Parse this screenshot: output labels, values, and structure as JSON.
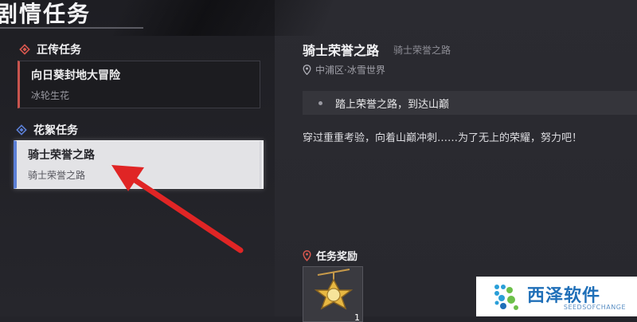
{
  "page": {
    "title": "剧情任务"
  },
  "sections": {
    "main": {
      "label": "正传任务",
      "icon": "main-quest-diamond-icon",
      "color": "#d9584f"
    },
    "side": {
      "label": "花絮任务",
      "icon": "side-quest-diamond-icon",
      "color": "#5b7fd6"
    }
  },
  "quests": {
    "main": {
      "name": "向日葵封地大冒险",
      "subtitle": "冰轮生花"
    },
    "selected": {
      "name": "骑士荣誉之路",
      "subtitle": "骑士荣誉之路"
    }
  },
  "detail": {
    "title": "骑士荣誉之路",
    "subtitle": "骑士荣誉之路",
    "location": "中浦区·冰雪世界",
    "objective": "踏上荣誉之路，到达山巅",
    "description": "穿过重重考验，向着山巅冲刺……为了无上的荣耀，努力吧！"
  },
  "rewards": {
    "label": "任务奖励",
    "items": [
      {
        "icon": "gold-star-medal-icon",
        "count": "1"
      }
    ]
  },
  "annotation": {
    "icon": "red-arrow-icon",
    "color": "#e02525"
  },
  "watermark": {
    "cn": "西泽软件",
    "en": "SEEDSOFCHANGE"
  }
}
